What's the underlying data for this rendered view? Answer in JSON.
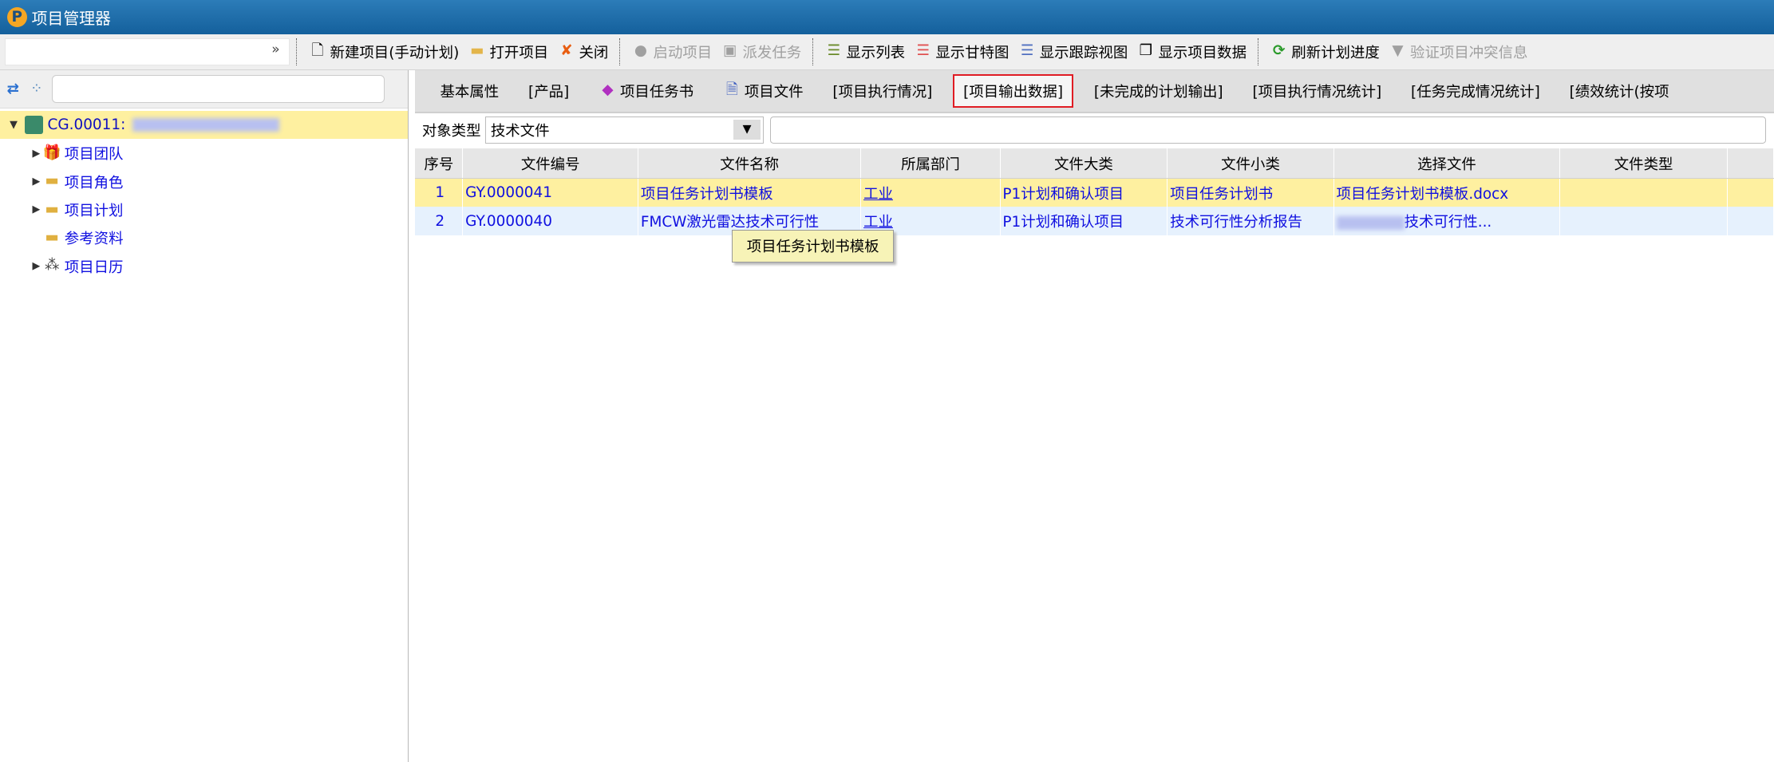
{
  "window": {
    "title": "项目管理器"
  },
  "toolbar": {
    "items": [
      {
        "label": "新建项目(手动计划)",
        "icon": "new-doc-icon",
        "enabled": true
      },
      {
        "label": "打开项目",
        "icon": "folder-open-icon",
        "enabled": true
      },
      {
        "label": "关闭",
        "icon": "close-icon",
        "enabled": true
      },
      {
        "label": "启动项目",
        "icon": "play-icon",
        "enabled": false
      },
      {
        "label": "派发任务",
        "icon": "dispatch-icon",
        "enabled": false
      },
      {
        "label": "显示列表",
        "icon": "list-icon",
        "enabled": true
      },
      {
        "label": "显示甘特图",
        "icon": "gantt-icon",
        "enabled": true
      },
      {
        "label": "显示跟踪视图",
        "icon": "tracking-icon",
        "enabled": true
      },
      {
        "label": "显示项目数据",
        "icon": "data-icon",
        "enabled": true
      },
      {
        "label": "刷新计划进度",
        "icon": "refresh-icon",
        "enabled": true
      },
      {
        "label": "验证项目冲突信息",
        "icon": "verify-icon",
        "enabled": false
      }
    ]
  },
  "tree": {
    "root": "CG.00011:",
    "children": [
      "项目团队",
      "项目角色",
      "项目计划",
      "参考资料",
      "项目日历"
    ]
  },
  "tabs": [
    "基本属性",
    "[产品]",
    "项目任务书",
    "项目文件",
    "[项目执行情况]",
    "[项目输出数据]",
    "[未完成的计划输出]",
    "[项目执行情况统计]",
    "[任务完成情况统计]",
    "[绩效统计(按项"
  ],
  "filter": {
    "label": "对象类型",
    "value": "技术文件"
  },
  "table": {
    "columns": [
      "序号",
      "文件编号",
      "文件名称",
      "所属部门",
      "文件大类",
      "文件小类",
      "选择文件",
      "文件类型"
    ],
    "rows": [
      [
        "1",
        "GY.0000041",
        "项目任务计划书模板",
        "工业",
        "P1计划和确认项目",
        "项目任务计划书",
        "项目任务计划书模板.docx",
        ""
      ],
      [
        "2",
        "GY.0000040",
        "FMCW激光雷达技术可行性",
        "工业",
        "P1计划和确认项目",
        "技术可行性分析报告",
        "技术可行性...",
        ""
      ]
    ]
  },
  "tooltip": "项目任务计划书模板"
}
